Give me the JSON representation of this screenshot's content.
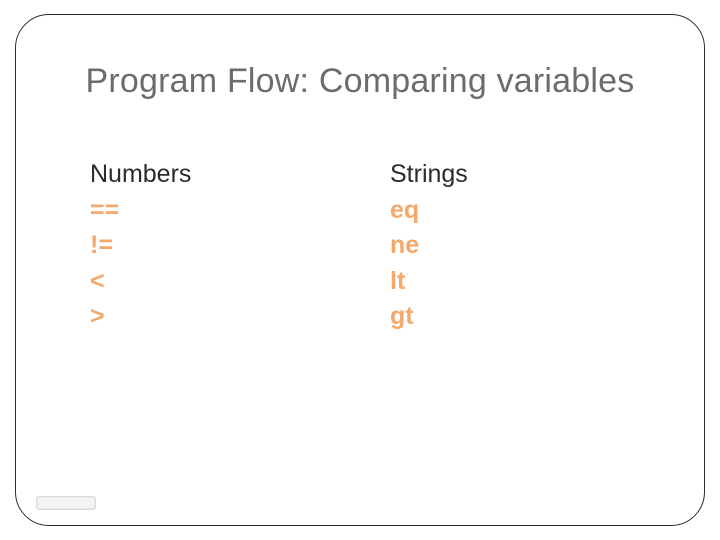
{
  "title": "Program Flow: Comparing variables",
  "columns": {
    "left": {
      "heading": "Numbers",
      "ops": [
        "==",
        "!=",
        "<",
        ">"
      ]
    },
    "right": {
      "heading": "Strings",
      "ops": [
        "eq",
        "ne",
        "lt",
        "gt"
      ]
    }
  }
}
